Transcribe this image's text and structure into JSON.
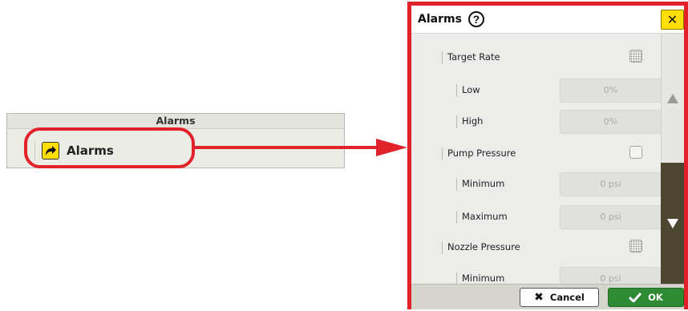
{
  "mini_panel": {
    "header": "Alarms",
    "item_label": "Alarms",
    "item_icon": "forward-arrow-icon"
  },
  "dialog": {
    "title": "Alarms",
    "help_icon": "question-circle-icon",
    "close_icon": "close-x-icon",
    "rows": [
      {
        "label": "Target Rate",
        "type": "group",
        "checkbox": "dotted"
      },
      {
        "label": "Low",
        "type": "field",
        "value": "0%"
      },
      {
        "label": "High",
        "type": "field",
        "value": "0%"
      },
      {
        "label": "Pump Pressure",
        "type": "group",
        "checkbox": "plain"
      },
      {
        "label": "Minimum",
        "type": "field",
        "value": "0 psi"
      },
      {
        "label": "Maximum",
        "type": "field",
        "value": "0 psi"
      },
      {
        "label": "Nozzle Pressure",
        "type": "group",
        "checkbox": "dotted"
      },
      {
        "label": "Minimum",
        "type": "field",
        "value": "0 psi"
      }
    ],
    "scroll_up_icon": "triangle-up-icon",
    "scroll_down_icon": "triangle-down-icon",
    "footer": {
      "cancel_label": "Cancel",
      "cancel_icon": "x-icon",
      "ok_label": "OK",
      "ok_icon": "checkmark-icon"
    }
  },
  "colors": {
    "highlight": "#e2222b",
    "accent_yellow": "#ffde00",
    "ok_green": "#2f8a34"
  }
}
